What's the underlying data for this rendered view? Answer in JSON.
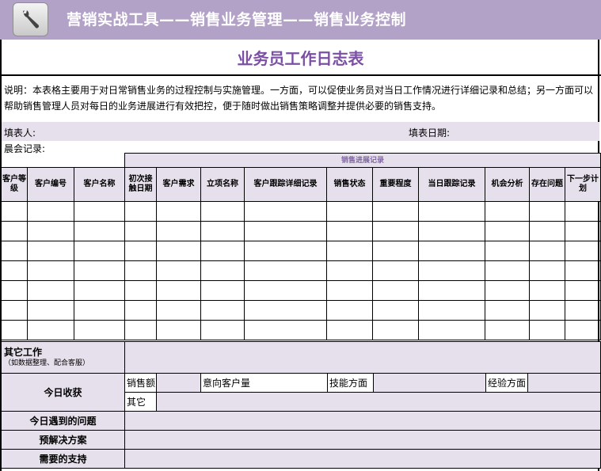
{
  "header": {
    "title": "营销实战工具——销售业务管理——销售业务控制",
    "icon": "wrench-icon"
  },
  "sheet": {
    "title": "业务员工作日志表",
    "description": "说明：本表格主要用于对日常销售业务的过程控制与实施管理。一方面，可以促使业务员对当日工作情况进行详细记录和总结；另一方面可以帮助销售管理人员对每日的业务进展进行有效把控，便于随时做出销售策略调整并提供必要的销售支持。",
    "filler_label": "填表人:",
    "date_label": "填表日期:",
    "morning_label": "晨会记录:"
  },
  "progress": {
    "group_label": "销售进展记录",
    "columns": [
      "客户等级",
      "客户编号",
      "客户名称",
      "初次接触日期",
      "客户需求",
      "立项名称",
      "客户跟踪详细记录",
      "销售状态",
      "重要程度",
      "当日跟踪记录",
      "机会分析",
      "存在问题",
      "下一步计划"
    ],
    "rows": [
      [
        "",
        "",
        "",
        "",
        "",
        "",
        "",
        "",
        "",
        "",
        "",
        "",
        ""
      ],
      [
        "",
        "",
        "",
        "",
        "",
        "",
        "",
        "",
        "",
        "",
        "",
        "",
        ""
      ],
      [
        "",
        "",
        "",
        "",
        "",
        "",
        "",
        "",
        "",
        "",
        "",
        "",
        ""
      ],
      [
        "",
        "",
        "",
        "",
        "",
        "",
        "",
        "",
        "",
        "",
        "",
        "",
        ""
      ],
      [
        "",
        "",
        "",
        "",
        "",
        "",
        "",
        "",
        "",
        "",
        "",
        "",
        ""
      ],
      [
        "",
        "",
        "",
        "",
        "",
        "",
        "",
        "",
        "",
        "",
        "",
        "",
        ""
      ],
      [
        "",
        "",
        "",
        "",
        "",
        "",
        "",
        "",
        "",
        "",
        "",
        "",
        ""
      ]
    ]
  },
  "summary": {
    "other_work_label": "其它工作",
    "other_work_note": "（如数据整理、配合客服）",
    "gains_label": "今日收获",
    "sales_label": "销售额",
    "prospect_label": "意向客户量",
    "skill_label": "技能方面",
    "experience_label": "经验方面",
    "other_label": "其它",
    "problems_label": "今日遇到的问题",
    "solutions_label": "预解决方案",
    "support_label": "需要的支持"
  }
}
